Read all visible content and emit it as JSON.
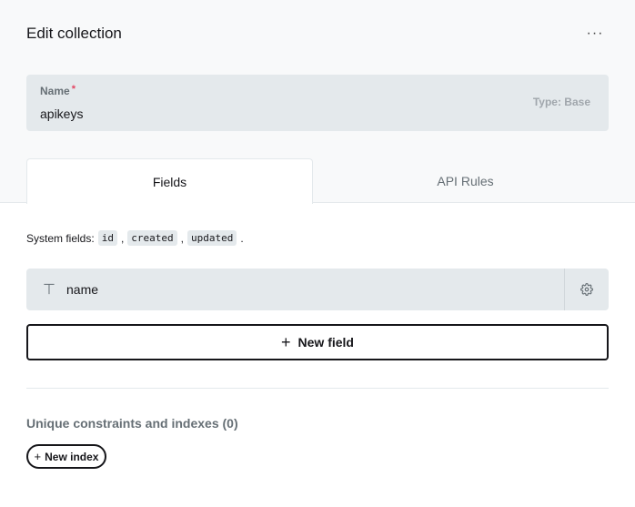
{
  "header": {
    "title": "Edit collection",
    "more_label": "···"
  },
  "name_field": {
    "label": "Name",
    "required_mark": "*",
    "value": "apikeys",
    "type_label": "Type: Base"
  },
  "tabs": [
    {
      "label": "Fields",
      "active": true
    },
    {
      "label": "API Rules",
      "active": false
    }
  ],
  "system_fields": {
    "prefix": "System fields:",
    "fields": [
      "id",
      "created",
      "updated"
    ],
    "separator": ",",
    "suffix": "."
  },
  "fields": [
    {
      "type_icon": "text-type-icon",
      "type_glyph": "⊤",
      "name": "name"
    }
  ],
  "new_field_button": {
    "plus": "+",
    "label": "New field"
  },
  "indexes": {
    "title": "Unique constraints and indexes (0)",
    "new_index_plus": "+",
    "new_index_label": "New index"
  },
  "colors": {
    "panel_bg": "#f8f9fa",
    "field_bg": "#e4e9ec",
    "text": "#16161a",
    "muted": "#666f75",
    "required": "#e34562"
  }
}
